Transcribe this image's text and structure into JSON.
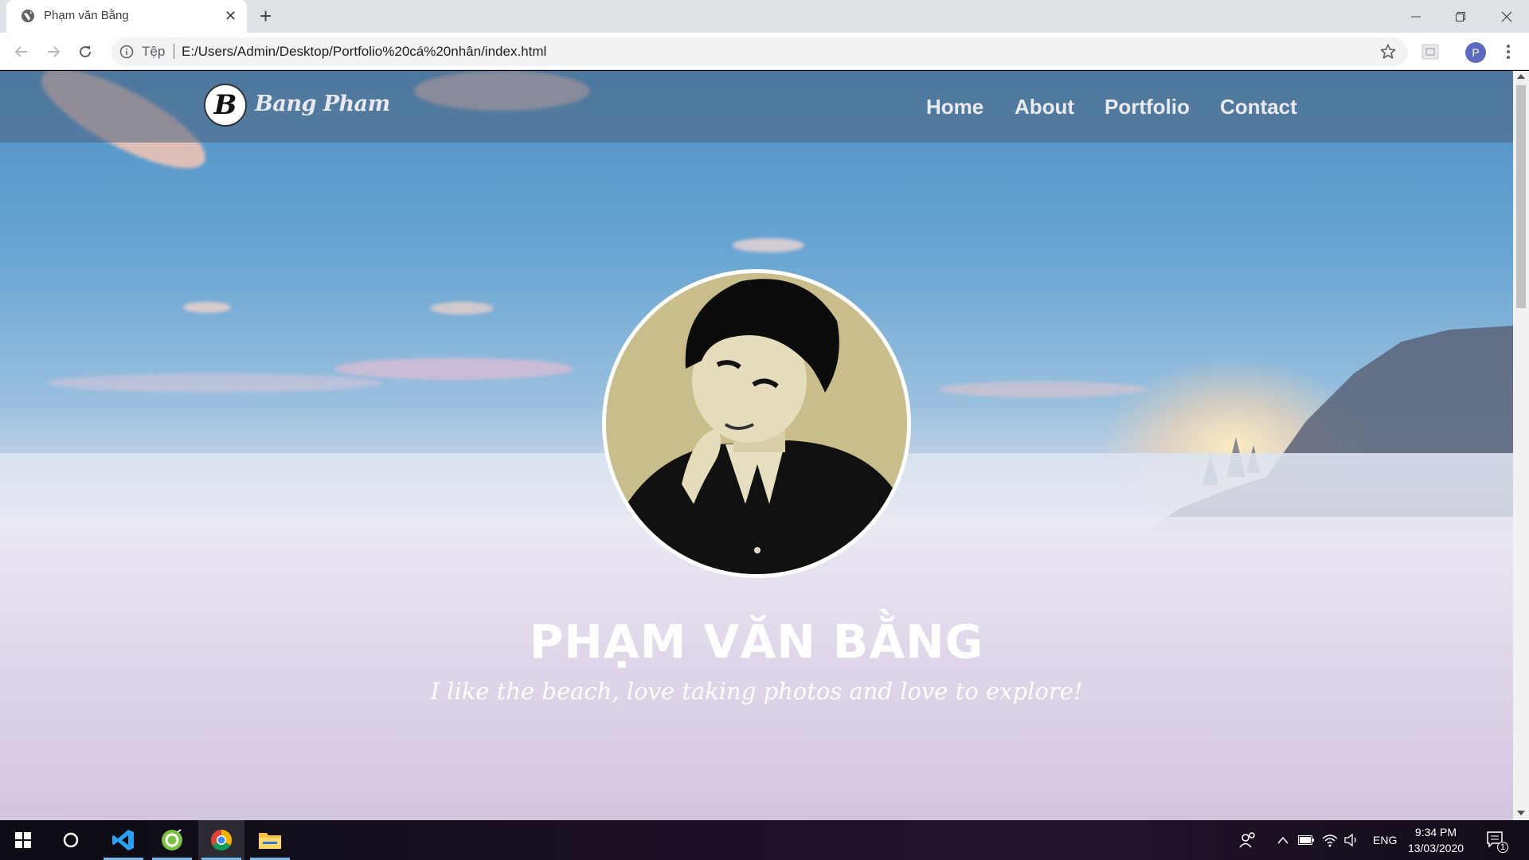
{
  "browser": {
    "tab_title": "Phạm văn Bằng",
    "url_chip": "Tệp",
    "url": "E:/Users/Admin/Desktop/Portfolio%20cá%20nhân/index.html",
    "profile_initial": "P"
  },
  "site": {
    "logo_letter": "B",
    "logo_text": "Bang Pham",
    "nav": [
      "Home",
      "About",
      "Portfolio",
      "Contact"
    ],
    "hero_name": "PHẠM VĂN BẰNG",
    "hero_tagline": "I like the beach, love taking photos and love to explore!"
  },
  "taskbar": {
    "language": "ENG",
    "time": "9:34 PM",
    "date": "13/03/2020",
    "notification_count": "1",
    "apps": [
      "start-icon",
      "cortana-icon",
      "vscode-icon",
      "greenshot-icon",
      "chrome-icon",
      "file-explorer-icon"
    ]
  },
  "colors": {
    "header_overlay": "#50647d",
    "nav_text": "#eaeaf0",
    "accent_active": "#76b9ed"
  }
}
